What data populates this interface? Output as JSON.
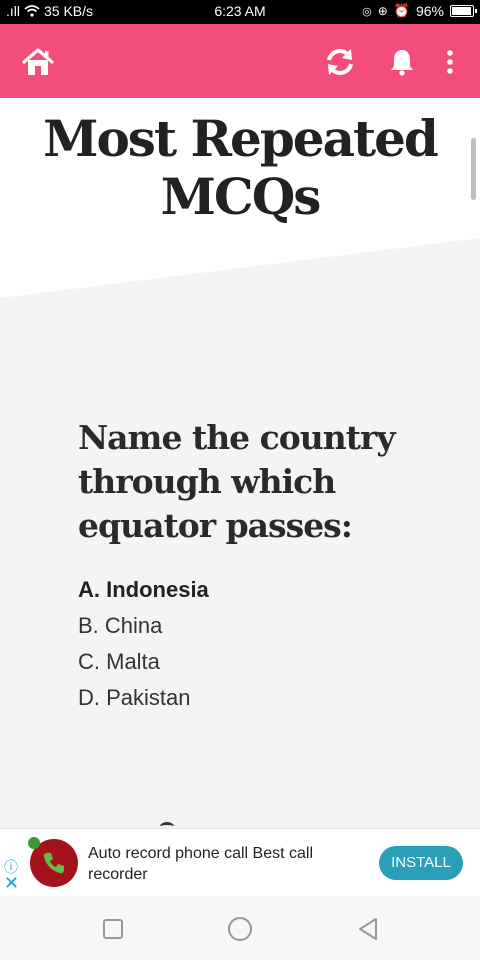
{
  "status_bar": {
    "signal": ".ıll",
    "network_speed": "35 KB/s",
    "time": "6:23 AM",
    "battery_percent": "96%",
    "battery_level": 0.96
  },
  "app_bar": {
    "background": "#f54d7b",
    "icons": [
      "home-icon",
      "refresh-icon",
      "bell-icon",
      "more-vertical-icon"
    ]
  },
  "content": {
    "title_line1": "Most Repeated",
    "title_line2": "MCQs",
    "question_line1": "Name the country",
    "question_line2": "through which",
    "question_line3": "equator passes:",
    "options": [
      {
        "label": "A. Indonesia",
        "correct": true
      },
      {
        "label": "B. China",
        "correct": false
      },
      {
        "label": "C. Malta",
        "correct": false
      },
      {
        "label": "D. Pakistan",
        "correct": false
      }
    ]
  },
  "ad": {
    "text_line1": "Auto record phone call Best call",
    "text_line2": "recorder",
    "install_label": "INSTALL",
    "info_icon": "ⓘ",
    "close_icon": "✕",
    "accent": "#2a9fb7"
  },
  "nav": {
    "icons": [
      "recent-apps-icon",
      "home-circle-icon",
      "back-triangle-icon"
    ]
  }
}
